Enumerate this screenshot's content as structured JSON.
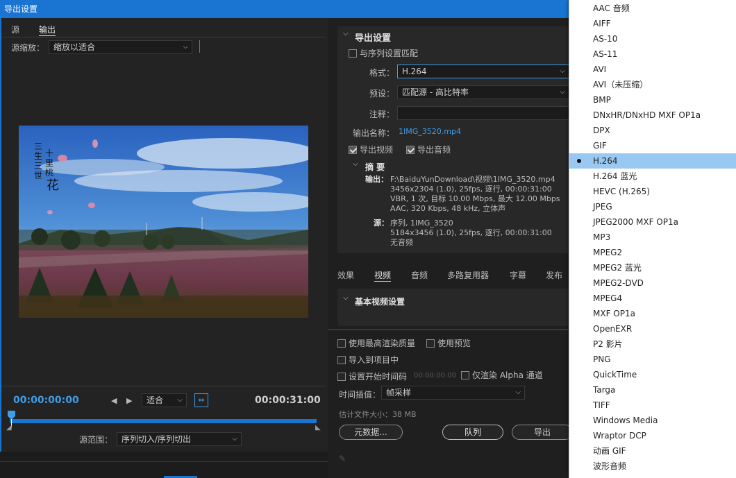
{
  "window": {
    "title": "导出设置"
  },
  "source_tabs": {
    "source": "源",
    "output": "输出"
  },
  "source_scale": {
    "label": "源缩放：",
    "value": "缩放以适合"
  },
  "preview": {
    "watermark_text": "三生三世十里桃花"
  },
  "timeline": {
    "current_time": "00:00:00:00",
    "fit_value": "适合",
    "end_time": "00:00:31:00",
    "range_label": "源范围：",
    "range_value": "序列切入/序列切出"
  },
  "export_settings": {
    "section_title": "导出设置",
    "match_sequence": "与序列设置匹配",
    "format_label": "格式：",
    "format_value": "H.264",
    "preset_label": "预设：",
    "preset_value": "匹配源 - 高比特率",
    "comment_label": "注释：",
    "comment_value": "",
    "output_name_label": "输出名称：",
    "output_name_value": "1IMG_3520.mp4",
    "export_video": "导出视频",
    "export_audio": "导出音频"
  },
  "summary": {
    "title": "摘 要",
    "output_label": "输出：",
    "output_lines": [
      "F:\\BaiduYunDownload\\视频\\1IMG_3520.mp4",
      "3456x2304 (1.0), 25fps, 逐行, 00:00:31:00",
      "VBR, 1 次, 目标 10.00 Mbps, 最大 12.00 Mbps",
      "AAC, 320 Kbps, 48 kHz, 立体声"
    ],
    "source_label": "源：",
    "source_lines": [
      "序列, 1IMG_3520",
      "5184x3456 (1.0), 25fps, 逐行, 00:00:31:00",
      "无音频"
    ]
  },
  "settings_tabs": [
    "效果",
    "视频",
    "音频",
    "多路复用器",
    "字幕",
    "发布"
  ],
  "video_section": {
    "title": "基本视频设置"
  },
  "options": {
    "max_render_quality": "使用最高渲染质量",
    "use_previews": "使用预览",
    "import_into_project": "导入到项目中",
    "set_start_timecode": "设置开始时间码",
    "start_timecode_value": "00:00:00:00",
    "render_alpha_only": "仅渲染 Alpha 通道",
    "time_interpolation_label": "时间插值：",
    "time_interpolation_value": "帧采样",
    "estimated_size": "估计文件大小：38 MB"
  },
  "buttons": {
    "metadata": "元数据...",
    "queue": "队列",
    "export": "导出"
  },
  "format_dropdown": {
    "selected": "H.264",
    "items": [
      "AAC 音频",
      "AIFF",
      "AS-10",
      "AS-11",
      "AVI",
      "AVI（未压缩）",
      "BMP",
      "DNxHR/DNxHD MXF OP1a",
      "DPX",
      "GIF",
      "H.264",
      "H.264 蓝光",
      "HEVC (H.265)",
      "JPEG",
      "JPEG2000 MXF OP1a",
      "MP3",
      "MPEG2",
      "MPEG2 蓝光",
      "MPEG2-DVD",
      "MPEG4",
      "MXF OP1a",
      "OpenEXR",
      "P2 影片",
      "PNG",
      "QuickTime",
      "Targa",
      "TIFF",
      "Windows Media",
      "Wraptor DCP",
      "动画 GIF",
      "波形音频"
    ]
  },
  "colors": {
    "accent": "#1a74d2",
    "timecode": "#3f9de8",
    "selection": "#99c9f2"
  }
}
